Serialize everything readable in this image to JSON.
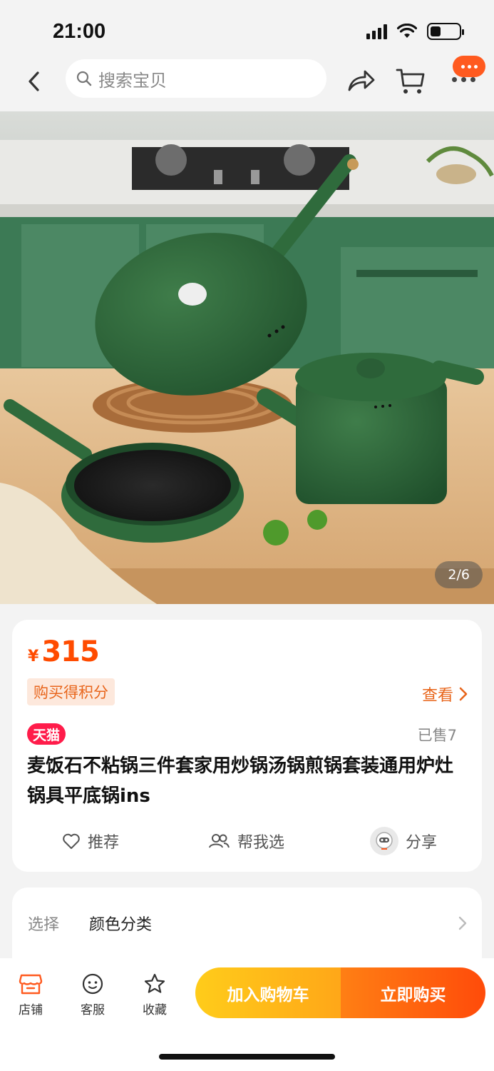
{
  "status_bar": {
    "time": "21:00"
  },
  "nav": {
    "search_placeholder": "搜索宝贝"
  },
  "hero": {
    "page_indicator": "2/6"
  },
  "price_card": {
    "currency": "¥",
    "price": "315",
    "points_badge": "购买得积分",
    "view_link": "查看",
    "store_badge": "天猫",
    "sold": "已售7",
    "title": "麦饭石不粘锅三件套家用炒锅汤锅煎锅套装通用炉灶锅具平底锅ins",
    "actions": {
      "recommend": "推荐",
      "help_choose": "帮我选",
      "share": "分享"
    }
  },
  "options": {
    "select_label": "选择",
    "select_value": "颜色分类"
  },
  "bottom_bar": {
    "store": "店铺",
    "service": "客服",
    "favorite": "收藏",
    "add_to_cart": "加入购物车",
    "buy_now": "立即购买"
  },
  "colors": {
    "accent": "#ff4b00",
    "tmall": "#ff1c4a",
    "cart_button": "#ffb818",
    "buy_button": "#ff5a0f",
    "product_green": "#2f6b3c"
  }
}
